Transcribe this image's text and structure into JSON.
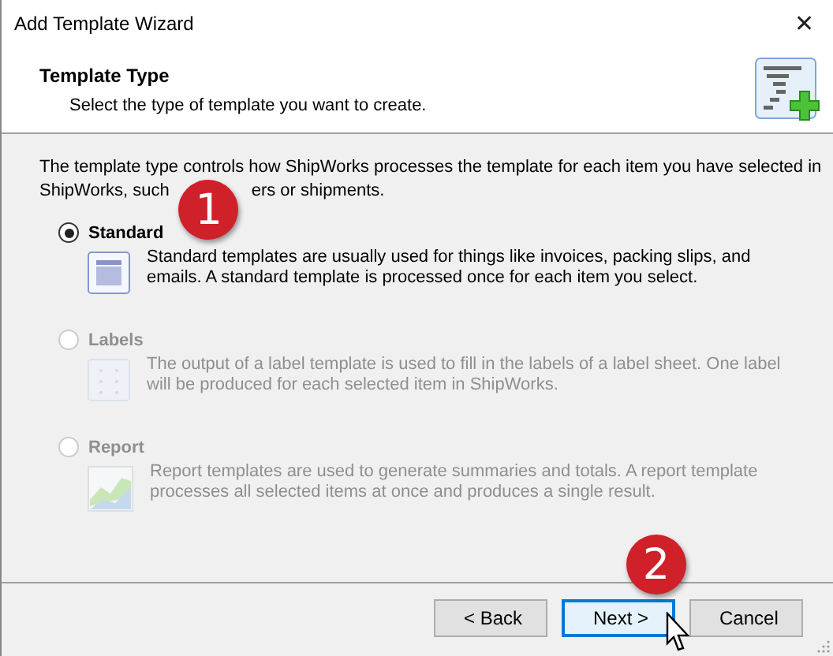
{
  "window": {
    "title": "Add Template Wizard",
    "close": "✕"
  },
  "header": {
    "title": "Template Type",
    "subtitle": "Select the type of template you want to create."
  },
  "intro": {
    "line_1": "The template type controls how ShipWorks processes the template for each item you have selected in",
    "line_2_start": "ShipWorks, such",
    "line_2_end": "ers or shipments."
  },
  "options": [
    {
      "label": "Standard",
      "selected": true,
      "disabled": false,
      "description": "Standard templates are usually used for things like invoices, packing slips, and emails. A standard template is processed once for each item you select."
    },
    {
      "label": "Labels",
      "selected": false,
      "disabled": true,
      "description": "The output of a label template is used to fill in the labels of a label sheet. One label will be produced for each selected item in ShipWorks."
    },
    {
      "label": "Report",
      "selected": false,
      "disabled": true,
      "description": "Report templates are used to generate summaries and totals.  A report template processes all selected items at once and produces a single result."
    }
  ],
  "buttons": [
    {
      "label": "< Back",
      "focused": false
    },
    {
      "label": "Next >",
      "focused": true
    },
    {
      "label": "Cancel",
      "focused": false
    }
  ],
  "callouts": [
    "1",
    "2"
  ]
}
